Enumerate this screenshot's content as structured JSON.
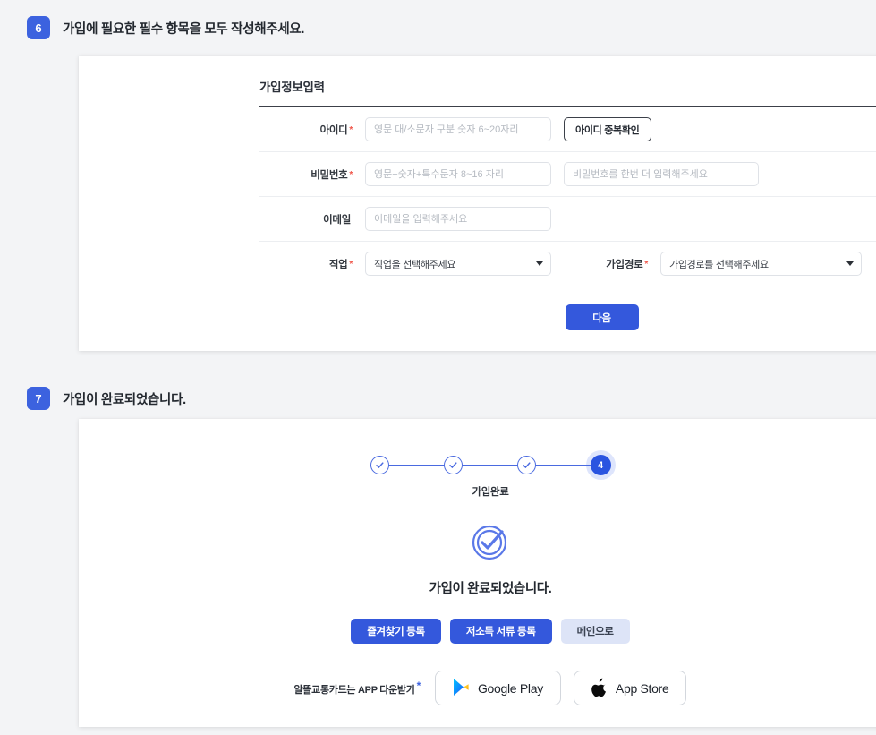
{
  "sections": [
    {
      "number": "6",
      "title": "가입에 필요한 필수 항목을 모두 작성해주세요."
    },
    {
      "number": "7",
      "title": "가입이 완료되었습니다."
    }
  ],
  "signup_form": {
    "heading": "가입정보입력",
    "fields": {
      "id": {
        "label": "아이디",
        "required_mark": "*",
        "placeholder": "영문 대/소문자 구분 숫자 6~20자리",
        "value": "",
        "dup_check_button": "아이디 중복확인"
      },
      "password": {
        "label": "비밀번호",
        "required_mark": "*",
        "placeholder": "영문+숫자+특수문자 8~16 자리",
        "value": "",
        "confirm_placeholder": "비밀번호를 한번 더 입력해주세요",
        "confirm_value": ""
      },
      "email": {
        "label": "이메일",
        "required_mark": "",
        "placeholder": "이메일을 입력해주세요",
        "value": ""
      },
      "job": {
        "label": "직업",
        "required_mark": "*",
        "selected": "직업을 선택해주세요"
      },
      "join_path": {
        "label": "가입경로",
        "required_mark": "*",
        "selected": "가입경로를 선택해주세요"
      }
    },
    "submit_button": "다음"
  },
  "completion": {
    "stepper": {
      "steps": [
        "done",
        "done",
        "done",
        "4"
      ],
      "active_number": "4",
      "caption": "가입완료"
    },
    "message": "가입이 완료되었습니다.",
    "buttons": [
      {
        "label": "즐겨찾기 등록",
        "style": "solid"
      },
      {
        "label": "저소득 서류 등록",
        "style": "solid"
      },
      {
        "label": "메인으로",
        "style": "ghost"
      }
    ],
    "app_download": {
      "text": "알뜰교통카드는 APP 다운받기",
      "asterisk": "*",
      "stores": [
        {
          "name": "google-play",
          "label": "Google Play"
        },
        {
          "name": "app-store",
          "label": "App Store"
        }
      ]
    }
  },
  "colors": {
    "accent": "#3458dc",
    "badge": "#3c62df",
    "required": "#f0564a",
    "ghost_button": "#dde4f7",
    "page_bg": "#f3f4f6"
  }
}
